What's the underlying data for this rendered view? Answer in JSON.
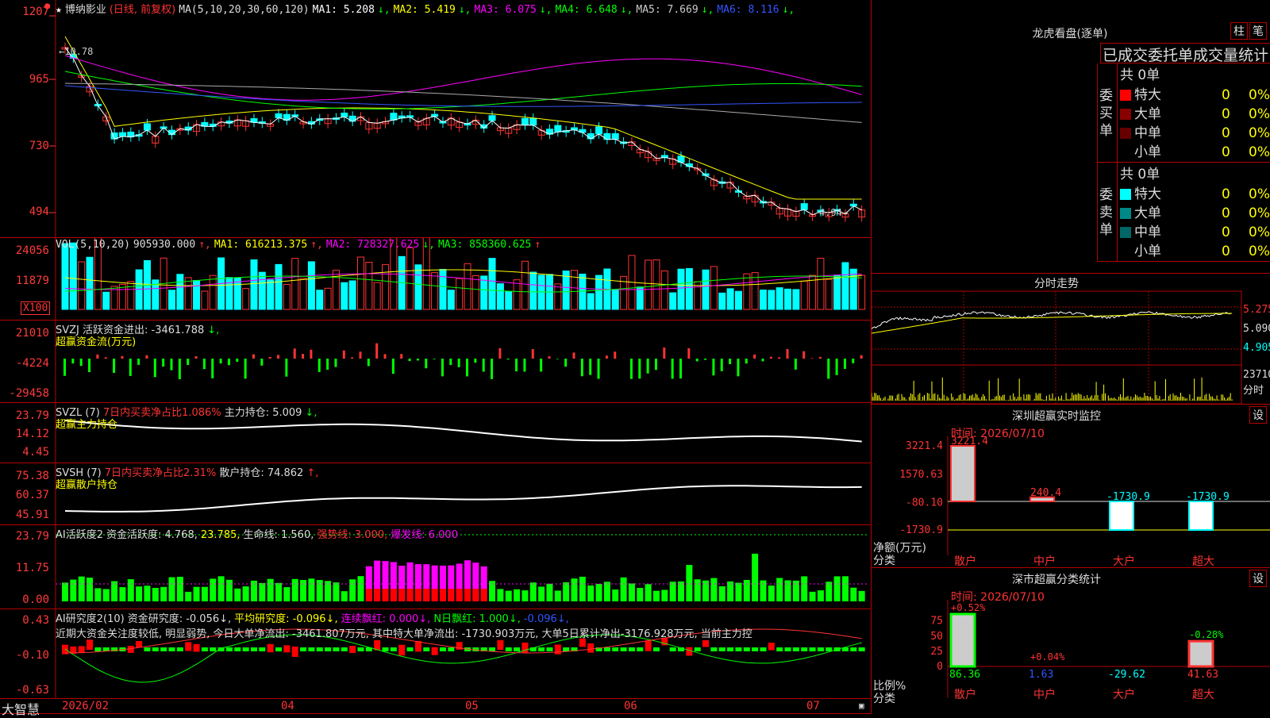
{
  "main_chart": {
    "stock_name": "博纳影业",
    "period_label": "(日线, 前复权)",
    "ma_header": "MA(5,10,20,30,60,120)",
    "ma_values": [
      {
        "label": "MA1: 5.208",
        "color": "#ffffff"
      },
      {
        "label": "MA2: 5.419",
        "color": "#ffff00"
      },
      {
        "label": "MA3: 6.075",
        "color": "#ff00ff"
      },
      {
        "label": "MA4: 6.648",
        "color": "#00ff00"
      },
      {
        "label": "MA5: 7.669",
        "color": "#cccccc"
      },
      {
        "label": "MA6: 8.116",
        "color": "#3355ff"
      }
    ],
    "y_ticks": [
      "1207",
      "965",
      "730",
      "494"
    ],
    "high_annotation": "10.78",
    "low_annotation": "4.94"
  },
  "vol_chart": {
    "header": "VOL(5,10,20)",
    "value": "905930.000",
    "ma1": "MA1: 616213.375",
    "ma2": "MA2: 728327.625",
    "ma3": "MA3: 858360.625",
    "y_ticks": [
      "24056",
      "11879"
    ],
    "unit": "X100"
  },
  "svzj": {
    "header": "SVZJ  活跃资金进出: -3461.788",
    "subtitle": "超赢资金流(万元)",
    "y_ticks": [
      "21010",
      "-4224",
      "-29458"
    ]
  },
  "svzl": {
    "header_prefix": "SVZL (7)",
    "header_red": "7日内买卖净占比1.086%",
    "header_suffix": "主力持仓: 5.009",
    "subtitle": "超赢主力持仓",
    "y_ticks": [
      "23.79",
      "14.12",
      "4.45"
    ]
  },
  "svsh": {
    "header_prefix": "SVSH (7)",
    "header_red": "7日内买卖净占比2.31%",
    "header_suffix": "散户持仓: 74.862",
    "subtitle": "超赢散户持仓",
    "y_ticks": [
      "75.38",
      "60.37",
      "45.91"
    ]
  },
  "ai_active": {
    "header": "AI活跃度2",
    "items": [
      {
        "label": "资金活跃度: 4.768",
        "color": "#dddddd"
      },
      {
        "label": "23.785",
        "color": "#ffff00"
      },
      {
        "label": "生命线: 1.560",
        "color": "#dddddd"
      },
      {
        "label": "强势线: 3.000",
        "color": "#ff3333"
      },
      {
        "label": "爆发线: 6.000",
        "color": "#ff00ff"
      }
    ],
    "y_ticks": [
      "23.79",
      "11.75",
      "0.00"
    ]
  },
  "ai_research": {
    "header": "AI研究度2(10)",
    "items": [
      {
        "label": "资金研究度: -0.056",
        "color": "#dddddd"
      },
      {
        "label": "平均研究度: -0.096",
        "color": "#ffff00"
      },
      {
        "label": "连续飘红: 0.000",
        "color": "#ff00ff"
      },
      {
        "label": "N日飘红: 1.000",
        "color": "#00ff00"
      },
      {
        "label": "-0.096",
        "color": "#3355ff"
      }
    ],
    "comment": "近期大资金关注度较低, 明显弱势, 今日大单净流出: -3461.807万元, 其中特大单净流出: -1730.903万元, 大单5日累计净出-3176.928万元, 当前主力控",
    "y_ticks": [
      "0.43",
      "-0.10",
      "-0.63"
    ]
  },
  "x_axis": {
    "brand": "大智慧",
    "labels": [
      "2026/02",
      "04",
      "05",
      "06",
      "07"
    ]
  },
  "longhu": {
    "title": "龙虎看盘(逐单)",
    "btn_bar": "柱",
    "btn_pen": "笔",
    "table_header": "已成交委托单成交量统计",
    "buy_label": "委买单",
    "sell_label": "委卖单",
    "buy_total": "共 0单",
    "sell_total": "共 0单",
    "buy_rows": [
      {
        "name": "特大",
        "color": "#ff0000",
        "count": "0",
        "pct": "0%"
      },
      {
        "name": "大单",
        "color": "#880000",
        "count": "0",
        "pct": "0%"
      },
      {
        "name": "中单",
        "color": "#660000",
        "count": "0",
        "pct": "0%"
      },
      {
        "name": "小单",
        "color": "#000000",
        "count": "0",
        "pct": "0%"
      }
    ],
    "sell_rows": [
      {
        "name": "特大",
        "color": "#00ffff",
        "count": "0",
        "pct": "0%"
      },
      {
        "name": "大单",
        "color": "#008888",
        "count": "0",
        "pct": "0%"
      },
      {
        "name": "中单",
        "color": "#006666",
        "count": "0",
        "pct": "0%"
      },
      {
        "name": "小单",
        "color": "#000000",
        "count": "0",
        "pct": "0%"
      }
    ]
  },
  "intraday": {
    "title": "分时走势",
    "price_ticks": [
      "5.275",
      "5.090",
      "4.905"
    ],
    "vol_tick": "23710",
    "vol_unit": "分时"
  },
  "sz_monitor": {
    "title": "深圳超赢实时监控",
    "btn": "设",
    "time": "时间: 2026/07/10",
    "y_ticks": [
      "3221.4",
      "1570.63",
      "-80.10",
      "-1730.9"
    ],
    "y_unit": "净额(万元)",
    "x_unit": "分类",
    "bars": [
      {
        "name": "散户",
        "value": 3221.4,
        "label": "3221.4",
        "color": "#ff3333"
      },
      {
        "name": "中户",
        "value": 240.4,
        "label": "240.4",
        "color": "#ff3333"
      },
      {
        "name": "大户",
        "value": -1730.9,
        "label": "-1730.9",
        "color": "#00ffff"
      },
      {
        "name": "超大",
        "value": -1730.9,
        "label": "-1730.9",
        "color": "#00ffff"
      }
    ]
  },
  "sz_class": {
    "title": "深市超赢分类统计",
    "btn": "设",
    "time": "时间: 2026/07/10",
    "y_ticks": [
      "75",
      "50",
      "25",
      "0"
    ],
    "y_unit": "比例%",
    "x_unit": "分类",
    "bars": [
      {
        "name": "散户",
        "pct_label": "+0.52%",
        "value": 86.36,
        "value_label": "86.36",
        "label_color": "#00ff00"
      },
      {
        "name": "中户",
        "pct_label": "+0.04%",
        "value": 1.63,
        "value_label": "1.63",
        "label_color": "#3355ff"
      },
      {
        "name": "大户",
        "pct_label": "",
        "value": -29.62,
        "value_label": "-29.62",
        "label_color": "#00ffff"
      },
      {
        "name": "超大",
        "pct_label": "-0.28%",
        "value": 41.63,
        "value_label": "41.63",
        "label_color": "#ff3333"
      }
    ]
  }
}
